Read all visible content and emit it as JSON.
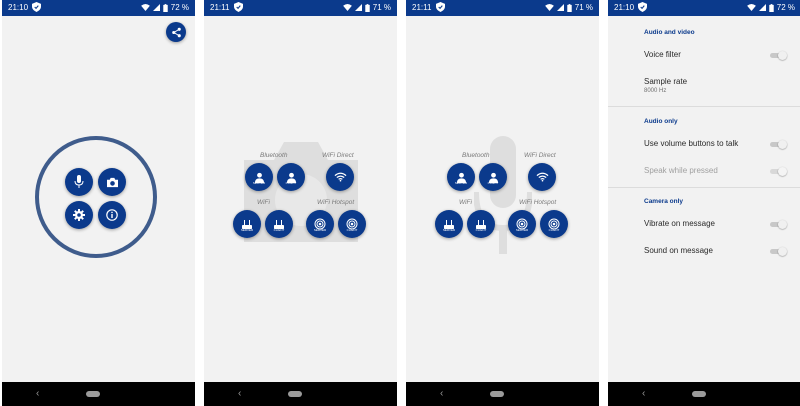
{
  "screens": [
    {
      "status": {
        "time": "21:10",
        "battery": "72 %"
      },
      "share_icon": "share-icon",
      "buttons": [
        "mic-icon",
        "camera-icon",
        "settings-icon",
        "info-icon"
      ]
    },
    {
      "status": {
        "time": "21:11",
        "battery": "71 %"
      },
      "labels": {
        "bluetooth": "Bluetooth",
        "wifi_direct": "WiFi Direct",
        "wifi": "WiFi",
        "wifi_hotspot": "WiFi Hotspot"
      },
      "tiny": {
        "server": "SERVER",
        "client": "CLIENT"
      }
    },
    {
      "status": {
        "time": "21:11",
        "battery": "71 %"
      },
      "labels": {
        "bluetooth": "Bluetooth",
        "wifi_direct": "WiFi Direct",
        "wifi": "WiFi",
        "wifi_hotspot": "WiFi Hotspot"
      },
      "tiny": {
        "server": "SERVER",
        "client": "CLIENT"
      }
    },
    {
      "status": {
        "time": "21:10",
        "battery": "72 %"
      },
      "settings": {
        "audio_video": "Audio and video",
        "voice_filter": "Voice filter",
        "sample_rate": "Sample rate",
        "sample_rate_value": "8000 Hz",
        "audio_only": "Audio only",
        "volume_buttons": "Use volume buttons to talk",
        "speak_while_pressed": "Speak while pressed",
        "camera_only": "Camera only",
        "vibrate": "Vibrate on message",
        "sound": "Sound on message"
      }
    }
  ],
  "colors": {
    "accent": "#0b3a8c",
    "ring": "#3f5c8c",
    "background": "#f2f2f2"
  }
}
